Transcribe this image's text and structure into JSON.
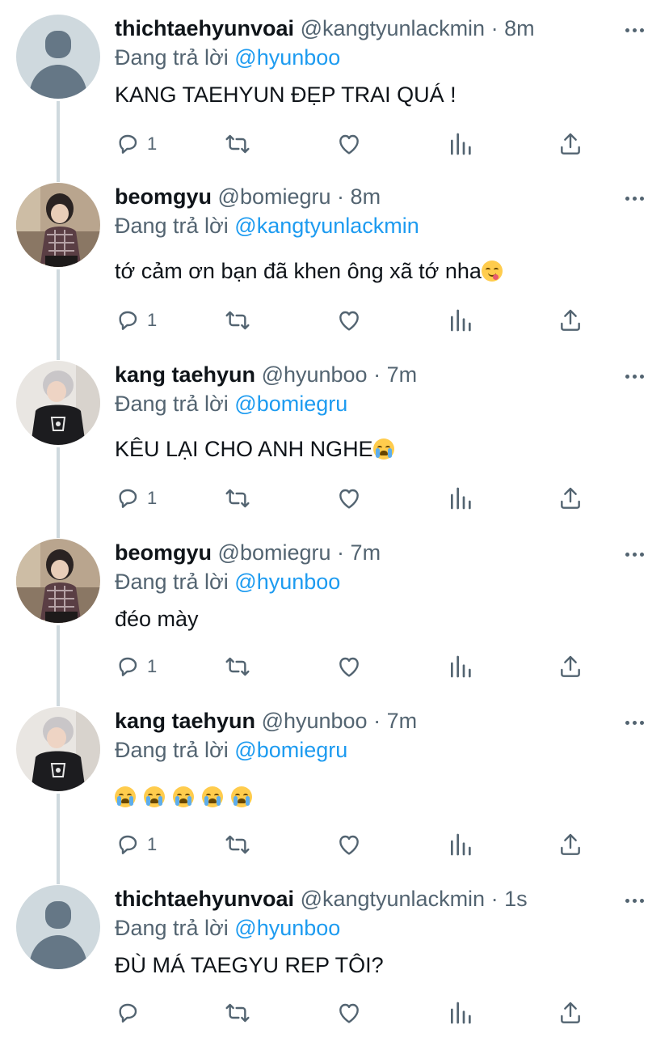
{
  "reply_prefix": "Đang trả lời",
  "tweets": [
    {
      "name": "thichtaehyunvoai",
      "handle": "@kangtyunlackmin",
      "separator": "·",
      "time": "8m",
      "reply_to": "@hyunboo",
      "text": "KANG TAEHYUN ĐẸP TRAI QUÁ !",
      "reply_count": "1",
      "avatar": "default-avatar"
    },
    {
      "name": "beomgyu",
      "handle": "@bomiegru",
      "separator": "·",
      "time": "8m",
      "reply_to": "@kangtyunlackmin",
      "text": "tớ cảm ơn bạn đã khen ông xã tớ nha",
      "emoji": "face-savoring-food",
      "reply_count": "1",
      "avatar": "photo-beomgyu"
    },
    {
      "name": "kang taehyun",
      "handle": "@hyunboo",
      "separator": "·",
      "time": "7m",
      "reply_to": "@bomiegru",
      "text": "KÊU LẠI CHO ANH NGHE",
      "emoji": "loudly-crying-face",
      "reply_count": "1",
      "avatar": "photo-taehyun"
    },
    {
      "name": "beomgyu",
      "handle": "@bomiegru",
      "separator": "·",
      "time": "7m",
      "reply_to": "@hyunboo",
      "text": "đéo mày",
      "reply_count": "1",
      "avatar": "photo-beomgyu"
    },
    {
      "name": "kang taehyun",
      "handle": "@hyunboo",
      "separator": "·",
      "time": "7m",
      "reply_to": "@bomiegru",
      "text": "",
      "emoji_row": [
        "loudly-crying-face",
        "loudly-crying-face",
        "loudly-crying-face",
        "loudly-crying-face",
        "loudly-crying-face"
      ],
      "reply_count": "1",
      "avatar": "photo-taehyun"
    },
    {
      "name": "thichtaehyunvoai",
      "handle": "@kangtyunlackmin",
      "separator": "·",
      "time": "1s",
      "reply_to": "@hyunboo",
      "text": "ĐÙ MÁ TAEGYU REP TÔI?",
      "reply_count": "",
      "avatar": "default-avatar"
    }
  ],
  "colors": {
    "link": "#1d9bf0",
    "secondary_text": "#536471",
    "primary_text": "#0f1419",
    "thread_line": "#cfd9de"
  },
  "action_icons": [
    "reply-icon",
    "retweet-icon",
    "like-icon",
    "analytics-icon",
    "share-icon"
  ]
}
